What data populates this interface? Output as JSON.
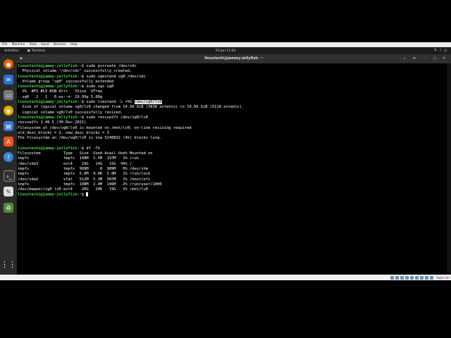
{
  "vbox_menu": [
    "File",
    "Machine",
    "View",
    "Input",
    "Devices",
    "Help"
  ],
  "topbar": {
    "activities": "Activities",
    "app_name": "Terminal",
    "clock": "22 Jan 11:03"
  },
  "terminal": {
    "title": "linuxtechi@jammy-jellyfish: ~",
    "prompt": "linuxtechi@jammy-jellyfish",
    "lines": [
      {
        "kind": "cmd",
        "cmd": " sudo pvcreate /dev/sdc"
      },
      {
        "kind": "out",
        "text": "  Physical volume \"/dev/sdc\" successfully created."
      },
      {
        "kind": "cmd",
        "cmd": " sudo vgextend vg0 /dev/sdc"
      },
      {
        "kind": "out",
        "text": "  Volume group \"vg0\" successfully extended"
      },
      {
        "kind": "cmd",
        "cmd": " sudo vgs vg0"
      },
      {
        "kind": "out",
        "text": "  VG  #PV #LV #SN Attr   VSize  VFree"
      },
      {
        "kind": "out",
        "text": "  vg0   2   1   0 wz--n- 19.99g 5.00g"
      },
      {
        "kind": "cmd",
        "cmd": " sudo lvextend -L +5G ",
        "sel": "/dev/vg0/lv0"
      },
      {
        "kind": "out",
        "text": "  Size of logical volume vg0/lv0 changed from 14.99 GiB (3838 extents) to 19.99 GiB (5118 extents)."
      },
      {
        "kind": "out",
        "text": "  Logical volume vg0/lv0 successfully resized."
      },
      {
        "kind": "cmd",
        "cmd": " sudo resize2fs /dev/vg0/lv0"
      },
      {
        "kind": "out",
        "text": "resize2fs 1.46.5 (30-Dec-2021)"
      },
      {
        "kind": "out",
        "text": "Filesystem at /dev/vg0/lv0 is mounted on /mnt/lv0; on-line resizing required"
      },
      {
        "kind": "out",
        "text": "old_desc_blocks = 2, new_desc_blocks = 3"
      },
      {
        "kind": "out",
        "text": "The filesystem on /dev/vg0/lv0 is now 5240832 (4k) blocks long."
      },
      {
        "kind": "blank",
        "text": ""
      },
      {
        "kind": "cmd",
        "cmd": " df -Th"
      },
      {
        "kind": "out",
        "text": "Filesystem          Type   Size  Used Avail Use% Mounted on"
      },
      {
        "kind": "out",
        "text": "tmpfs               tmpfs  198M  1.5M  197M   1% /run"
      },
      {
        "kind": "out",
        "text": "/dev/sda3           ext4    29G   14G   15G  49% /"
      },
      {
        "kind": "out",
        "text": "tmpfs               tmpfs  989M     0  989M   0% /dev/shm"
      },
      {
        "kind": "out",
        "text": "tmpfs               tmpfs  5.0M  4.0K  5.0M   1% /run/lock"
      },
      {
        "kind": "out",
        "text": "/dev/sda2           vfat   512M  5.3M  507M   2% /boot/efi"
      },
      {
        "kind": "out",
        "text": "tmpfs               tmpfs  198M  2.4M  196M   2% /run/user/1000"
      },
      {
        "kind": "out",
        "text": "/dev/mapper/vg0-lv0 ext4    20G   24K   19G   1% /mnt/lv0"
      },
      {
        "kind": "last",
        "cmd": " "
      }
    ]
  },
  "dock_icons": [
    "firefox-icon",
    "thunderbird-icon",
    "files-icon",
    "rhythmbox-icon",
    "writer-icon",
    "software-icon",
    "help-icon",
    "terminal-icon",
    "text-editor-icon",
    "trash-icon",
    "app-grid-icon"
  ],
  "vbox_status": {
    "host_key": "Right Ctrl"
  }
}
